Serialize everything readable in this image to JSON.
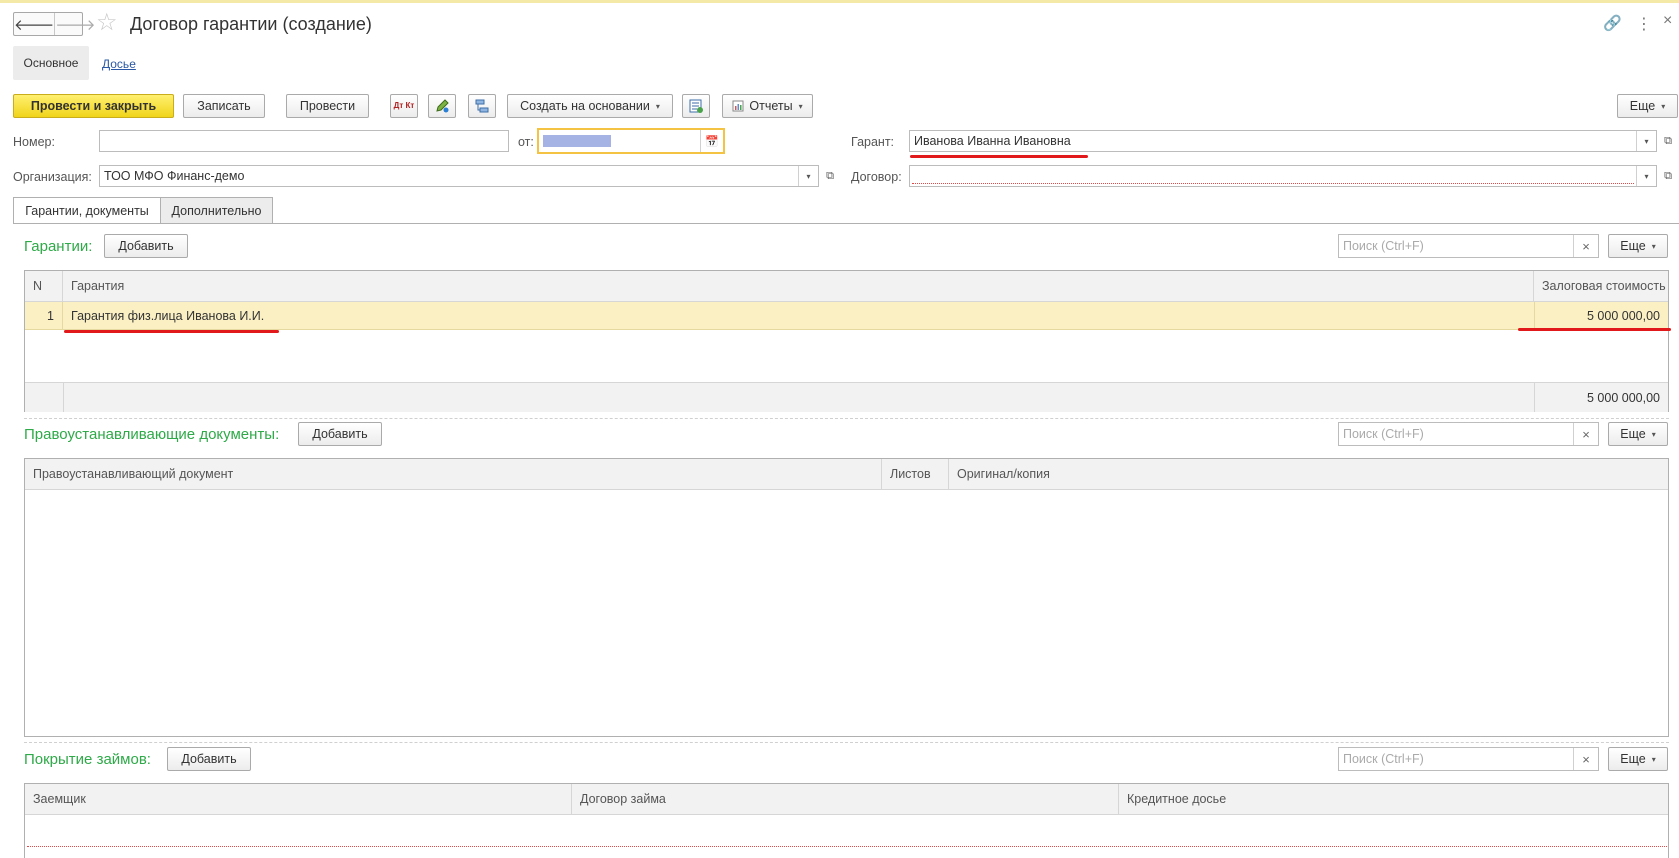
{
  "window": {
    "title": "Договор гарантии (создание)",
    "nav_back": "🡐",
    "nav_forward": "🡒",
    "star": "☆",
    "link_icon": "🔗",
    "menu_icon": "⋮",
    "close_icon": "×"
  },
  "page_tabs": [
    {
      "label": "Основное"
    },
    {
      "label": "Досье"
    }
  ],
  "toolbar": {
    "post_close": "Провести и закрыть",
    "save": "Записать",
    "post": "Провести",
    "icon1": "Дт Кт",
    "create_based": "Создать на основании",
    "reports": "Отчеты",
    "more": "Еще",
    "caret": "▾"
  },
  "form": {
    "number_label": "Номер:",
    "number_value": "",
    "date_label": "от:",
    "date_value": "",
    "calendar_icon": "📅",
    "org_label": "Организация:",
    "org_value": "ТОО МФО Финанс-демо",
    "guarantor_label": "Гарант:",
    "guarantor_value": "Иванова Иванна Ивановна",
    "contract_label": "Договор:",
    "contract_value": "",
    "open_icon": "⧉",
    "dd": "▾"
  },
  "subtabs": [
    {
      "label": "Гарантии, документы"
    },
    {
      "label": "Дополнительно"
    }
  ],
  "guarantees": {
    "title": "Гарантии:",
    "add": "Добавить",
    "search_placeholder": "Поиск (Ctrl+F)",
    "clear": "×",
    "more": "Еще",
    "columns": [
      "N",
      "Гарантия",
      "Залоговая стоимость"
    ],
    "rows": [
      {
        "n": "1",
        "name": "Гарантия физ.лица Иванова И.И.",
        "value": "5 000 000,00"
      }
    ],
    "total": "5 000 000,00"
  },
  "title_docs": {
    "title": "Правоустанавливающие документы:",
    "add": "Добавить",
    "search_placeholder": "Поиск (Ctrl+F)",
    "clear": "×",
    "more": "Еще",
    "columns": [
      "Правоустанавливающий документ",
      "Листов",
      "Оригинал/копия"
    ]
  },
  "loans": {
    "title": "Покрытие займов:",
    "add": "Добавить",
    "search_placeholder": "Поиск (Ctrl+F)",
    "clear": "×",
    "more": "Еще",
    "columns": [
      "Заемщик",
      "Договор займа",
      "Кредитное досье"
    ]
  },
  "colors": {
    "accent_yellow": "#f0d41a",
    "section_green": "#2eaa48",
    "selected_row": "#fbf0c4",
    "underline_red": "#e2191b",
    "date_focus": "#f4c344"
  }
}
